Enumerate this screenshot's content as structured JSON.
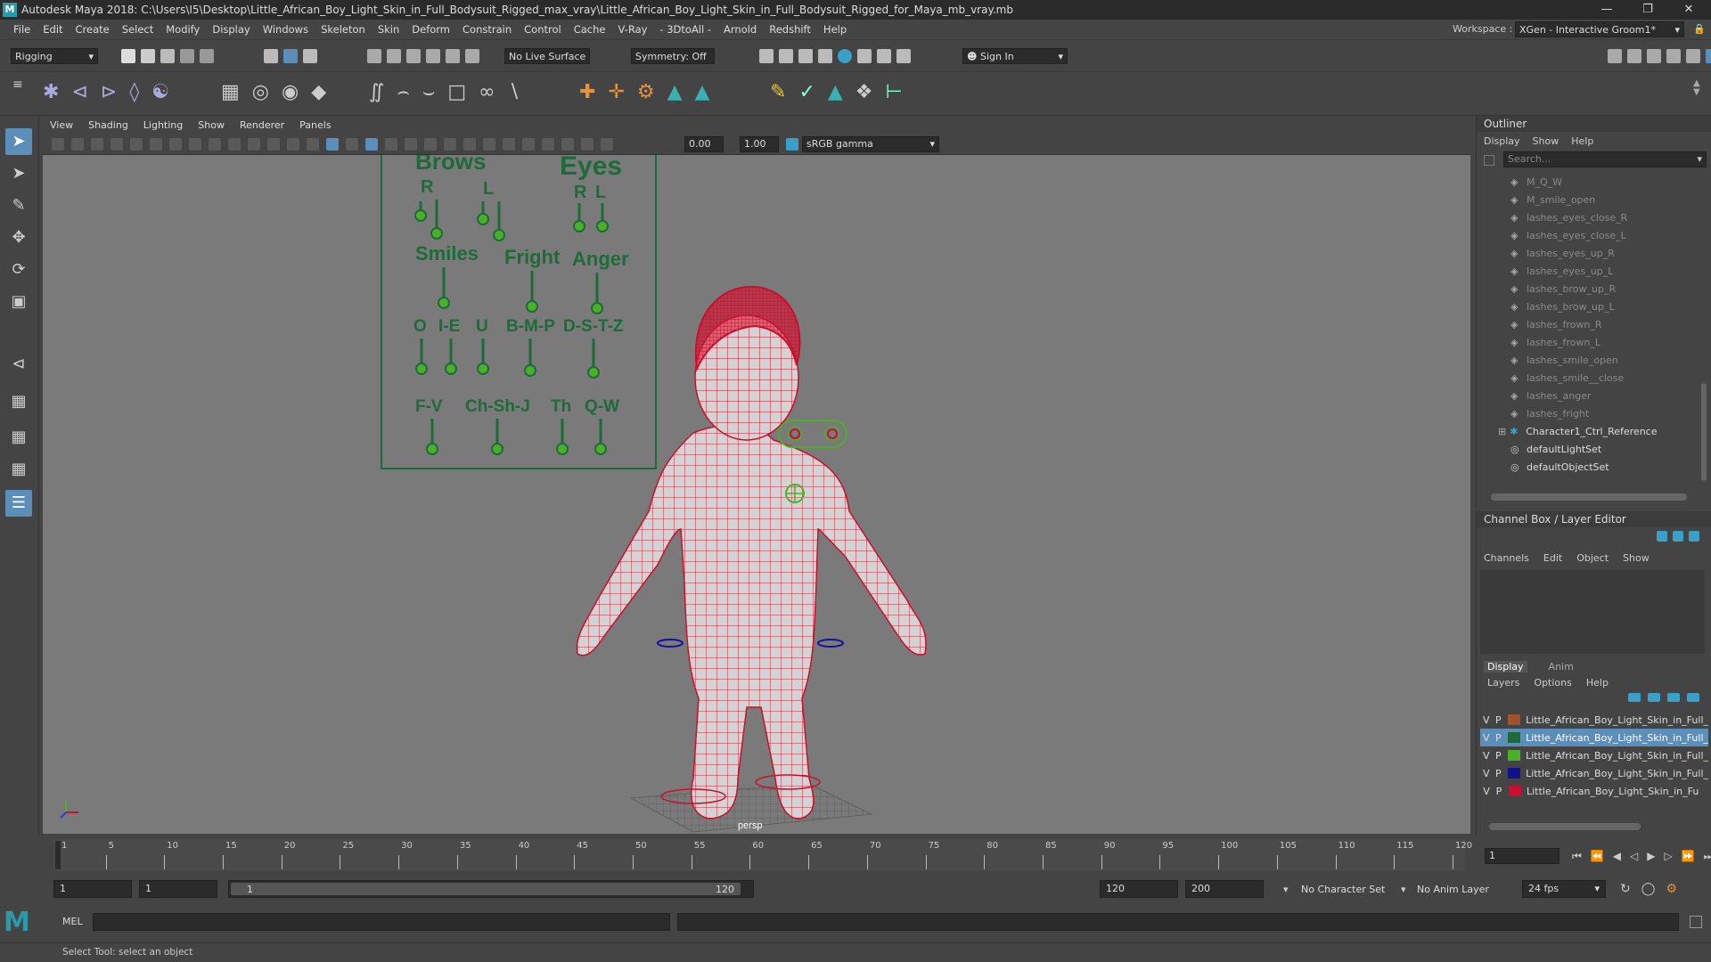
{
  "titlebar": {
    "title": "Autodesk Maya 2018: C:\\Users\\I5\\Desktop\\Little_African_Boy_Light_Skin_in_Full_Bodysuit_Rigged_max_vray\\Little_African_Boy_Light_Skin_in_Full_Bodysuit_Rigged_for_Maya_mb_vray.mb",
    "logo": "M"
  },
  "menubar": {
    "items": [
      "File",
      "Edit",
      "Create",
      "Select",
      "Modify",
      "Display",
      "Windows",
      "Skeleton",
      "Skin",
      "Deform",
      "Constrain",
      "Control",
      "Cache",
      "V-Ray",
      "- 3DtoAll -",
      "Arnold",
      "Redshift",
      "Help"
    ],
    "workspace_label": "Workspace :",
    "workspace_value": "XGen - Interactive Groom1*"
  },
  "statusline": {
    "mode": "Rigging",
    "live_surface": "No Live Surface",
    "symmetry": "Symmetry: Off",
    "sign_in": "Sign In"
  },
  "viewport": {
    "menu": [
      "View",
      "Shading",
      "Lighting",
      "Show",
      "Renderer",
      "Panels"
    ],
    "exposure": "0.00",
    "gamma": "1.00",
    "color_space": "sRGB gamma",
    "camera_label": "persp",
    "face_board": {
      "brows": "Brows",
      "eyes": "Eyes",
      "r1": "R",
      "l1": "L",
      "r2": "R",
      "l2": "L",
      "smiles": "Smiles",
      "fright": "Fright",
      "anger": "Anger",
      "o": "O",
      "ie": "I-E",
      "u": "U",
      "bmp": "B-M-P",
      "dstz": "D-S-T-Z",
      "fv": "F-V",
      "chshj": "Ch-Sh-J",
      "th": "Th",
      "qw": "Q-W"
    }
  },
  "outliner": {
    "title": "Outliner",
    "menu": [
      "Display",
      "Show",
      "Help"
    ],
    "search_placeholder": "Search...",
    "items": [
      {
        "label": "M_Q_W",
        "dim": true
      },
      {
        "label": "M_smile_open",
        "dim": true
      },
      {
        "label": "lashes_eyes_close_R",
        "dim": true
      },
      {
        "label": "lashes_eyes_close_L",
        "dim": true
      },
      {
        "label": "lashes_eyes_up_R",
        "dim": true
      },
      {
        "label": "lashes_eyes_up_L",
        "dim": true
      },
      {
        "label": "lashes_brow_up_R",
        "dim": true
      },
      {
        "label": "lashes_brow_up_L",
        "dim": true
      },
      {
        "label": "lashes_frown_R",
        "dim": true
      },
      {
        "label": "lashes_frown_L",
        "dim": true
      },
      {
        "label": "lashes_smile_open",
        "dim": true
      },
      {
        "label": "lashes_smile__close",
        "dim": true
      },
      {
        "label": "lashes_anger",
        "dim": true
      },
      {
        "label": "lashes_fright",
        "dim": true
      },
      {
        "label": "Character1_Ctrl_Reference",
        "dim": false
      },
      {
        "label": "defaultLightSet",
        "dim": false
      },
      {
        "label": "defaultObjectSet",
        "dim": false
      }
    ]
  },
  "channelbox": {
    "title": "Channel Box / Layer Editor",
    "menu": [
      "Channels",
      "Edit",
      "Object",
      "Show"
    ],
    "tabs": [
      "Display",
      "Anim"
    ],
    "layer_menu": [
      "Layers",
      "Options",
      "Help"
    ],
    "layers": [
      {
        "v": "V",
        "p": "P",
        "color": "#a0522d",
        "label": "Little_African_Boy_Light_Skin_in_Full_",
        "selected": false
      },
      {
        "v": "V",
        "p": "P",
        "color": "#1e6b3a",
        "label": "Little_African_Boy_Light_Skin_in_Full_",
        "selected": true
      },
      {
        "v": "V",
        "p": "P",
        "color": "#4caf2a",
        "label": "Little_African_Boy_Light_Skin_in_Full_",
        "selected": false
      },
      {
        "v": "V",
        "p": "P",
        "color": "#10108a",
        "label": "Little_African_Boy_Light_Skin_in_Full_",
        "selected": false
      },
      {
        "v": "V",
        "p": "P",
        "color": "#c8102e",
        "label": "Little_African_Boy_Light_Skin_in_Fu",
        "selected": false
      }
    ]
  },
  "timeslider": {
    "ticks": [
      "1",
      "5",
      "10",
      "15",
      "20",
      "25",
      "30",
      "35",
      "40",
      "45",
      "50",
      "55",
      "60",
      "65",
      "70",
      "75",
      "80",
      "85",
      "90",
      "95",
      "100",
      "105",
      "110",
      "115",
      "120"
    ],
    "current_frame": "1"
  },
  "rangebar": {
    "start": "1",
    "playback_start": "1",
    "range_start_label": "1",
    "range_end_label": "120",
    "playback_end": "120",
    "end": "200",
    "character_set": "No Character Set",
    "anim_layer": "No Anim Layer",
    "fps": "24 fps"
  },
  "cmdline": {
    "label": "MEL"
  },
  "helpline": {
    "text": "Select Tool: select an object"
  }
}
